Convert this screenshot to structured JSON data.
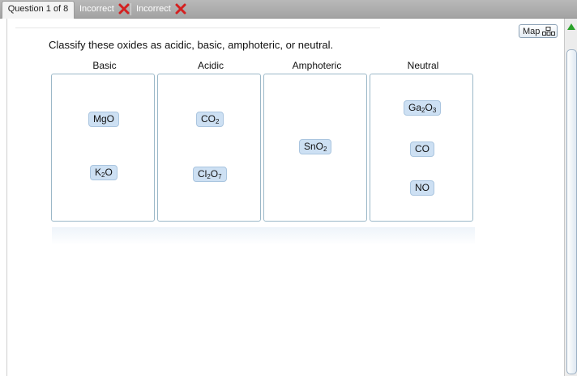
{
  "tabs": [
    {
      "label": "Question 1 of 8",
      "active": true
    },
    {
      "label": "Incorrect",
      "status_icon": "red-x-icon"
    },
    {
      "label": "Incorrect",
      "status_icon": "red-x-icon"
    }
  ],
  "map_button": {
    "label": "Map",
    "icon": "map-grid-icon"
  },
  "question_text": "Classify these oxides as acidic, basic, amphoteric, or neutral.",
  "bins": [
    {
      "header": "Basic",
      "items": [
        [
          "MgO"
        ],
        [
          "K",
          "2",
          "O"
        ]
      ]
    },
    {
      "header": "Acidic",
      "items": [
        [
          "CO",
          "2",
          ""
        ],
        [
          "Cl",
          "2",
          "O",
          "7",
          ""
        ]
      ]
    },
    {
      "header": "Amphoteric",
      "items": [
        [
          "SnO",
          "2",
          ""
        ]
      ]
    },
    {
      "header": "Neutral",
      "items": [
        [
          "Ga",
          "2",
          "O",
          "3",
          ""
        ],
        [
          "CO"
        ],
        [
          "NO"
        ]
      ]
    }
  ],
  "colors": {
    "chip_bg": "#cde0f3",
    "bin_border": "#9bb8c8",
    "incorrect_x": "#d42020",
    "scroll_arrow": "#2aa12a"
  }
}
